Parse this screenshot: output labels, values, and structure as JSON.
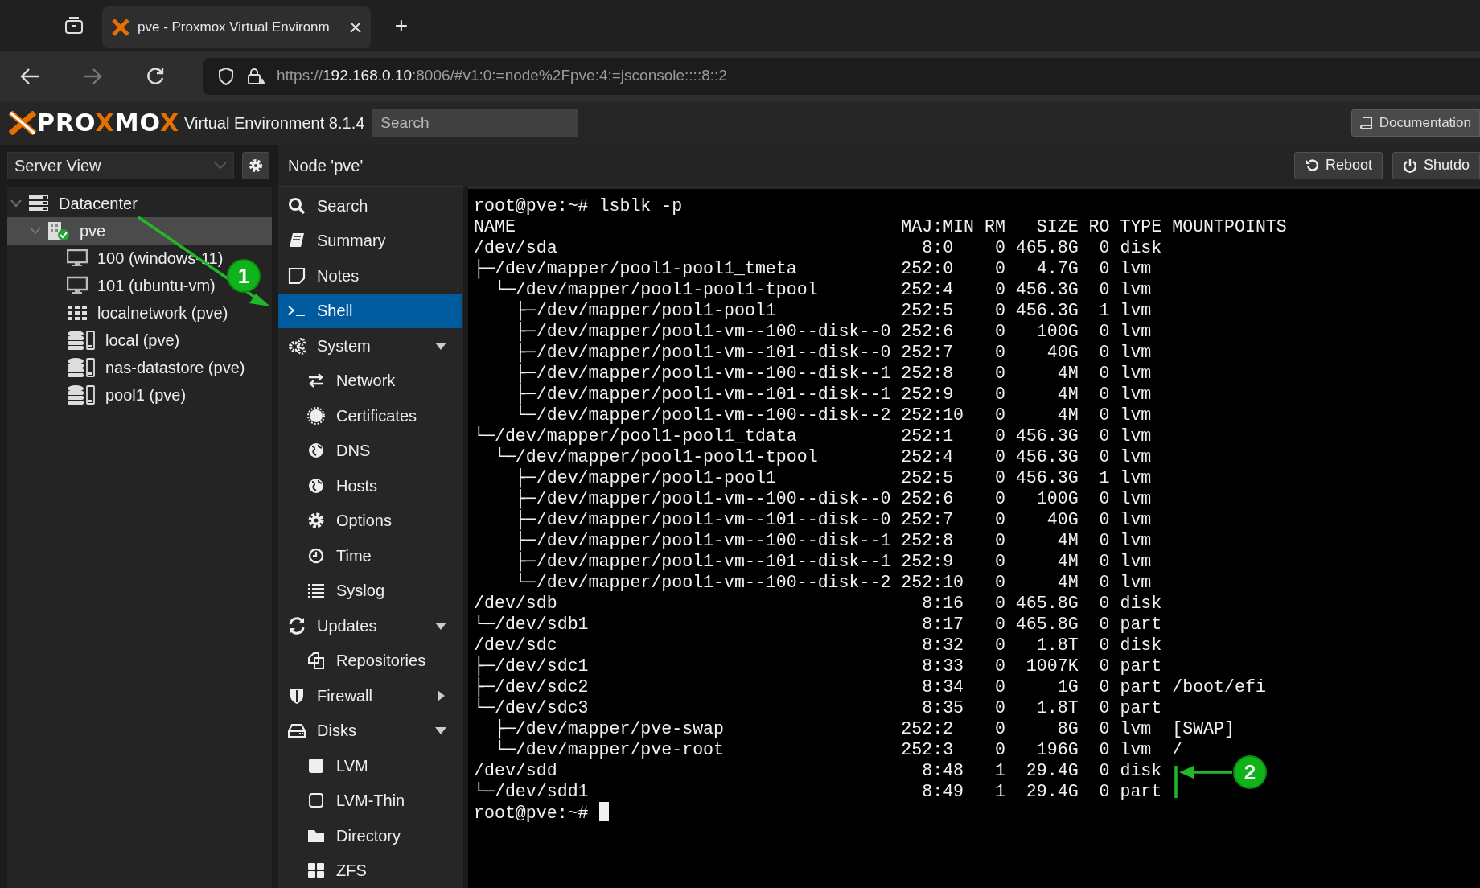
{
  "browser": {
    "tab": {
      "title": "pve - Proxmox Virtual Environm",
      "selected": true
    },
    "new_tab": "+",
    "url": {
      "before": "https://",
      "host": "192.168.0.10",
      "after": ":8006/#v1:0:=node%2Fpve:4:=jsconsole::::8::2"
    }
  },
  "header": {
    "logo": [
      {
        "text": "PRO",
        "accent": false
      },
      {
        "text": "X",
        "accent": true
      },
      {
        "text": "MO",
        "accent": false
      },
      {
        "text": "X",
        "accent": true
      }
    ],
    "product": "Virtual Environment 8.1.4",
    "search": {
      "placeholder": "Search"
    },
    "documentation": "Documentation"
  },
  "view_selector": {
    "value": "Server View"
  },
  "tree": [
    {
      "label": "Datacenter",
      "kind": "datacenter",
      "expanded": true,
      "selected": false,
      "children": [
        {
          "label": "pve",
          "kind": "node",
          "expanded": true,
          "selected": true,
          "children": [
            {
              "label": "100 (windows-11)",
              "kind": "vm",
              "selected": false
            },
            {
              "label": "101 (ubuntu-vm)",
              "kind": "vm",
              "selected": false
            },
            {
              "label": "localnetwork (pve)",
              "kind": "sdn",
              "selected": false
            },
            {
              "label": "local (pve)",
              "kind": "storage",
              "selected": false
            },
            {
              "label": "nas-datastore (pve)",
              "kind": "storage",
              "selected": false
            },
            {
              "label": "pool1 (pve)",
              "kind": "storage",
              "selected": false
            }
          ]
        }
      ]
    }
  ],
  "panel": {
    "title": "Node 'pve'",
    "buttons": [
      {
        "label": "Reboot",
        "kind": "reboot"
      },
      {
        "label": "Shutdo",
        "kind": "shutdown"
      }
    ]
  },
  "nav": [
    {
      "label": "Search",
      "selected": false
    },
    {
      "label": "Summary",
      "selected": false
    },
    {
      "label": "Notes",
      "selected": false
    },
    {
      "label": "Shell",
      "selected": true
    },
    {
      "label": "System",
      "selected": false,
      "expanded": true,
      "children": [
        {
          "label": "Network",
          "selected": false
        },
        {
          "label": "Certificates",
          "selected": false
        },
        {
          "label": "DNS",
          "selected": false
        },
        {
          "label": "Hosts",
          "selected": false
        },
        {
          "label": "Options",
          "selected": false
        },
        {
          "label": "Time",
          "selected": false
        },
        {
          "label": "Syslog",
          "selected": false
        }
      ]
    },
    {
      "label": "Updates",
      "selected": false,
      "expanded": true,
      "children": [
        {
          "label": "Repositories",
          "selected": false
        }
      ]
    },
    {
      "label": "Firewall",
      "selected": false,
      "expanded": false
    },
    {
      "label": "Disks",
      "selected": false,
      "expanded": true,
      "children": [
        {
          "label": "LVM",
          "selected": false
        },
        {
          "label": "LVM-Thin",
          "selected": false
        },
        {
          "label": "Directory",
          "selected": false
        },
        {
          "label": "ZFS",
          "selected": false
        }
      ]
    }
  ],
  "terminal": {
    "command_line": "root@pve:~# lsblk -p",
    "columns": [
      "NAME",
      "MAJ:MIN",
      "RM",
      "SIZE",
      "RO",
      "TYPE",
      "MOUNTPOINTS"
    ],
    "devices": [
      {
        "name": "/dev/sda",
        "maj_min": "8:0",
        "rm": "0",
        "size": "465.8G",
        "ro": "0",
        "type": "disk",
        "children": [
          {
            "branch": "├─",
            "name": "/dev/mapper/pool1-pool1_tmeta",
            "maj_min": "252:0",
            "rm": "0",
            "size": "4.7G",
            "ro": "0",
            "type": "lvm",
            "children": [
              {
                "branch": "└─",
                "name": "/dev/mapper/pool1-pool1-tpool",
                "maj_min": "252:4",
                "rm": "0",
                "size": "456.3G",
                "ro": "0",
                "type": "lvm",
                "children": [
                  {
                    "branch": "├─",
                    "name": "/dev/mapper/pool1-pool1",
                    "maj_min": "252:5",
                    "rm": "0",
                    "size": "456.3G",
                    "ro": "1",
                    "type": "lvm"
                  },
                  {
                    "branch": "├─",
                    "name": "/dev/mapper/pool1-vm--100--disk--0",
                    "maj_min": "252:6",
                    "rm": "0",
                    "size": "100G",
                    "ro": "0",
                    "type": "lvm"
                  },
                  {
                    "branch": "├─",
                    "name": "/dev/mapper/pool1-vm--101--disk--0",
                    "maj_min": "252:7",
                    "rm": "0",
                    "size": "40G",
                    "ro": "0",
                    "type": "lvm"
                  },
                  {
                    "branch": "├─",
                    "name": "/dev/mapper/pool1-vm--100--disk--1",
                    "maj_min": "252:8",
                    "rm": "0",
                    "size": "4M",
                    "ro": "0",
                    "type": "lvm"
                  },
                  {
                    "branch": "├─",
                    "name": "/dev/mapper/pool1-vm--101--disk--1",
                    "maj_min": "252:9",
                    "rm": "0",
                    "size": "4M",
                    "ro": "0",
                    "type": "lvm"
                  },
                  {
                    "branch": "└─",
                    "name": "/dev/mapper/pool1-vm--100--disk--2",
                    "maj_min": "252:10",
                    "rm": "0",
                    "size": "4M",
                    "ro": "0",
                    "type": "lvm"
                  }
                ]
              }
            ]
          },
          {
            "branch": "└─",
            "name": "/dev/mapper/pool1-pool1_tdata",
            "maj_min": "252:1",
            "rm": "0",
            "size": "456.3G",
            "ro": "0",
            "type": "lvm",
            "children": [
              {
                "branch": "└─",
                "name": "/dev/mapper/pool1-pool1-tpool",
                "maj_min": "252:4",
                "rm": "0",
                "size": "456.3G",
                "ro": "0",
                "type": "lvm",
                "children": [
                  {
                    "branch": "├─",
                    "name": "/dev/mapper/pool1-pool1",
                    "maj_min": "252:5",
                    "rm": "0",
                    "size": "456.3G",
                    "ro": "1",
                    "type": "lvm"
                  },
                  {
                    "branch": "├─",
                    "name": "/dev/mapper/pool1-vm--100--disk--0",
                    "maj_min": "252:6",
                    "rm": "0",
                    "size": "100G",
                    "ro": "0",
                    "type": "lvm"
                  },
                  {
                    "branch": "├─",
                    "name": "/dev/mapper/pool1-vm--101--disk--0",
                    "maj_min": "252:7",
                    "rm": "0",
                    "size": "40G",
                    "ro": "0",
                    "type": "lvm"
                  },
                  {
                    "branch": "├─",
                    "name": "/dev/mapper/pool1-vm--100--disk--1",
                    "maj_min": "252:8",
                    "rm": "0",
                    "size": "4M",
                    "ro": "0",
                    "type": "lvm"
                  },
                  {
                    "branch": "├─",
                    "name": "/dev/mapper/pool1-vm--101--disk--1",
                    "maj_min": "252:9",
                    "rm": "0",
                    "size": "4M",
                    "ro": "0",
                    "type": "lvm"
                  },
                  {
                    "branch": "└─",
                    "name": "/dev/mapper/pool1-vm--100--disk--2",
                    "maj_min": "252:10",
                    "rm": "0",
                    "size": "4M",
                    "ro": "0",
                    "type": "lvm"
                  }
                ]
              }
            ]
          }
        ]
      },
      {
        "name": "/dev/sdb",
        "maj_min": "8:16",
        "rm": "0",
        "size": "465.8G",
        "ro": "0",
        "type": "disk",
        "children": [
          {
            "branch": "└─",
            "name": "/dev/sdb1",
            "maj_min": "8:17",
            "rm": "0",
            "size": "465.8G",
            "ro": "0",
            "type": "part"
          }
        ]
      },
      {
        "name": "/dev/sdc",
        "maj_min": "8:32",
        "rm": "0",
        "size": "1.8T",
        "ro": "0",
        "type": "disk",
        "children": [
          {
            "branch": "├─",
            "name": "/dev/sdc1",
            "maj_min": "8:33",
            "rm": "0",
            "size": "1007K",
            "ro": "0",
            "type": "part"
          },
          {
            "branch": "├─",
            "name": "/dev/sdc2",
            "maj_min": "8:34",
            "rm": "0",
            "size": "1G",
            "ro": "0",
            "type": "part",
            "mountpoint": "/boot/efi"
          },
          {
            "branch": "└─",
            "name": "/dev/sdc3",
            "maj_min": "8:35",
            "rm": "0",
            "size": "1.8T",
            "ro": "0",
            "type": "part",
            "children": [
              {
                "branch": "├─",
                "name": "/dev/mapper/pve-swap",
                "maj_min": "252:2",
                "rm": "0",
                "size": "8G",
                "ro": "0",
                "type": "lvm",
                "mountpoint": "[SWAP]"
              },
              {
                "branch": "└─",
                "name": "/dev/mapper/pve-root",
                "maj_min": "252:3",
                "rm": "0",
                "size": "196G",
                "ro": "0",
                "type": "lvm",
                "mountpoint": "/"
              }
            ]
          }
        ]
      },
      {
        "name": "/dev/sdd",
        "maj_min": "8:48",
        "rm": "1",
        "size": "29.4G",
        "ro": "0",
        "type": "disk",
        "children": [
          {
            "branch": "└─",
            "name": "/dev/sdd1",
            "maj_min": "8:49",
            "rm": "1",
            "size": "29.4G",
            "ro": "0",
            "type": "part"
          }
        ]
      }
    ],
    "prompt": "root@pve:~#"
  },
  "annotations": [
    {
      "label": "1",
      "kind": "diagonal"
    },
    {
      "label": "2",
      "kind": "bracket"
    }
  ]
}
